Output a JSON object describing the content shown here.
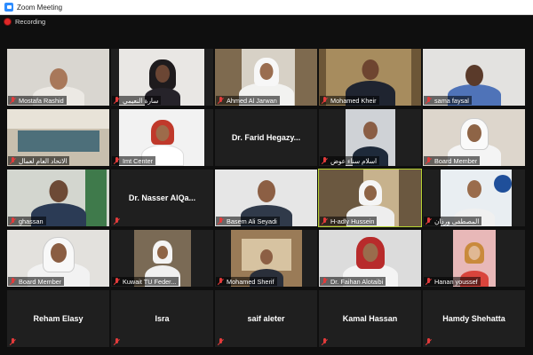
{
  "window": {
    "title": "Zoom Meeting"
  },
  "recording": {
    "label": "Recording"
  },
  "participants": [
    {
      "name": "Mostafa Rashid"
    },
    {
      "name": "سارة النعيمي"
    },
    {
      "name": "Ahmed Al Jarwan"
    },
    {
      "name": "Mohamed Kheir"
    },
    {
      "name": "sama faysal"
    },
    {
      "name": "الاتحاد العام لعمال"
    },
    {
      "name": "Imt Center"
    },
    {
      "name": "Dr. Farid Hegazy..."
    },
    {
      "name": "اسلام سناء عوض"
    },
    {
      "name": "Board Member"
    },
    {
      "name": "ghassan"
    },
    {
      "name": "Dr. Nasser AlQa..."
    },
    {
      "name": "Basem Ali Seyadi"
    },
    {
      "name": "H-adly Hussein"
    },
    {
      "name": "المصطفى ورذان"
    },
    {
      "name": "Board Member"
    },
    {
      "name": "Kuwait TU Feder..."
    },
    {
      "name": "Mohamed Sherif"
    },
    {
      "name": "Dr. Faihan Alotaibi"
    },
    {
      "name": "Hanan youssef"
    },
    {
      "name": "Reham Elasy"
    },
    {
      "name": "Isra"
    },
    {
      "name": "saif aleter"
    },
    {
      "name": "Kamal Hassan"
    },
    {
      "name": "Hamdy Shehatta"
    }
  ]
}
